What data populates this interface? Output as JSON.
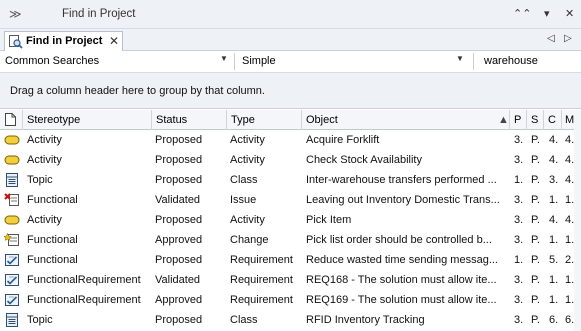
{
  "window": {
    "title": "Find in Project",
    "collapse_glyph": "≫",
    "controls": [
      "⌃⌃",
      "▾",
      "✕"
    ]
  },
  "tab": {
    "label": "Find in Project",
    "close": "✕",
    "nav": [
      "◁",
      "▷"
    ]
  },
  "search": {
    "category": "Common Searches",
    "type": "Simple",
    "term": "warehouse",
    "dropdown_glyph": "▼"
  },
  "groupbar": {
    "hint": "Drag a column header here to group by that column."
  },
  "columns": [
    {
      "key": "icon",
      "label": ""
    },
    {
      "key": "stereotype",
      "label": "Stereotype"
    },
    {
      "key": "status",
      "label": "Status"
    },
    {
      "key": "type",
      "label": "Type"
    },
    {
      "key": "object",
      "label": "Object",
      "sort": "▲"
    },
    {
      "key": "p",
      "label": "P"
    },
    {
      "key": "s",
      "label": "S"
    },
    {
      "key": "c",
      "label": "C"
    },
    {
      "key": "m",
      "label": "M"
    }
  ],
  "rows": [
    {
      "icon": "activity-icon",
      "stereotype": "Activity",
      "status": "Proposed",
      "type": "Activity",
      "object": "Acquire Forklift",
      "p": "3.",
      "s": "P.",
      "c": "4.",
      "m": "4."
    },
    {
      "icon": "activity-icon",
      "stereotype": "Activity",
      "status": "Proposed",
      "type": "Activity",
      "object": "Check Stock Availability",
      "p": "3.",
      "s": "P.",
      "c": "4.",
      "m": "4."
    },
    {
      "icon": "class-icon",
      "stereotype": "Topic",
      "status": "Proposed",
      "type": "Class",
      "object": "Inter-warehouse transfers performed ...",
      "p": "1.",
      "s": "P.",
      "c": "3.",
      "m": "4."
    },
    {
      "icon": "issue-icon",
      "stereotype": "Functional",
      "status": "Validated",
      "type": "Issue",
      "object": "Leaving out Inventory Domestic Trans...",
      "p": "3.",
      "s": "P.",
      "c": "1.",
      "m": "1."
    },
    {
      "icon": "activity-icon",
      "stereotype": "Activity",
      "status": "Proposed",
      "type": "Activity",
      "object": "Pick Item",
      "p": "3.",
      "s": "P.",
      "c": "4.",
      "m": "4."
    },
    {
      "icon": "change-icon",
      "stereotype": "Functional",
      "status": "Approved",
      "type": "Change",
      "object": "Pick list order should be controlled b...",
      "p": "3.",
      "s": "P.",
      "c": "1.",
      "m": "1."
    },
    {
      "icon": "requirement-icon",
      "stereotype": "Functional",
      "status": "Proposed",
      "type": "Requirement",
      "object": "Reduce wasted time sending messag...",
      "p": "1.",
      "s": "P.",
      "c": "5.",
      "m": "2."
    },
    {
      "icon": "requirement-icon",
      "stereotype": "FunctionalRequirement",
      "status": "Validated",
      "type": "Requirement",
      "object": "REQ168 - The solution must allow ite...",
      "p": "3.",
      "s": "P.",
      "c": "1.",
      "m": "1."
    },
    {
      "icon": "requirement-icon",
      "stereotype": "FunctionalRequirement",
      "status": "Approved",
      "type": "Requirement",
      "object": "REQ169 - The solution must allow ite...",
      "p": "3.",
      "s": "P.",
      "c": "1.",
      "m": "1."
    },
    {
      "icon": "class-icon",
      "stereotype": "Topic",
      "status": "Proposed",
      "type": "Class",
      "object": "RFID Inventory Tracking",
      "p": "3.",
      "s": "P.",
      "c": "6.",
      "m": "6."
    }
  ]
}
